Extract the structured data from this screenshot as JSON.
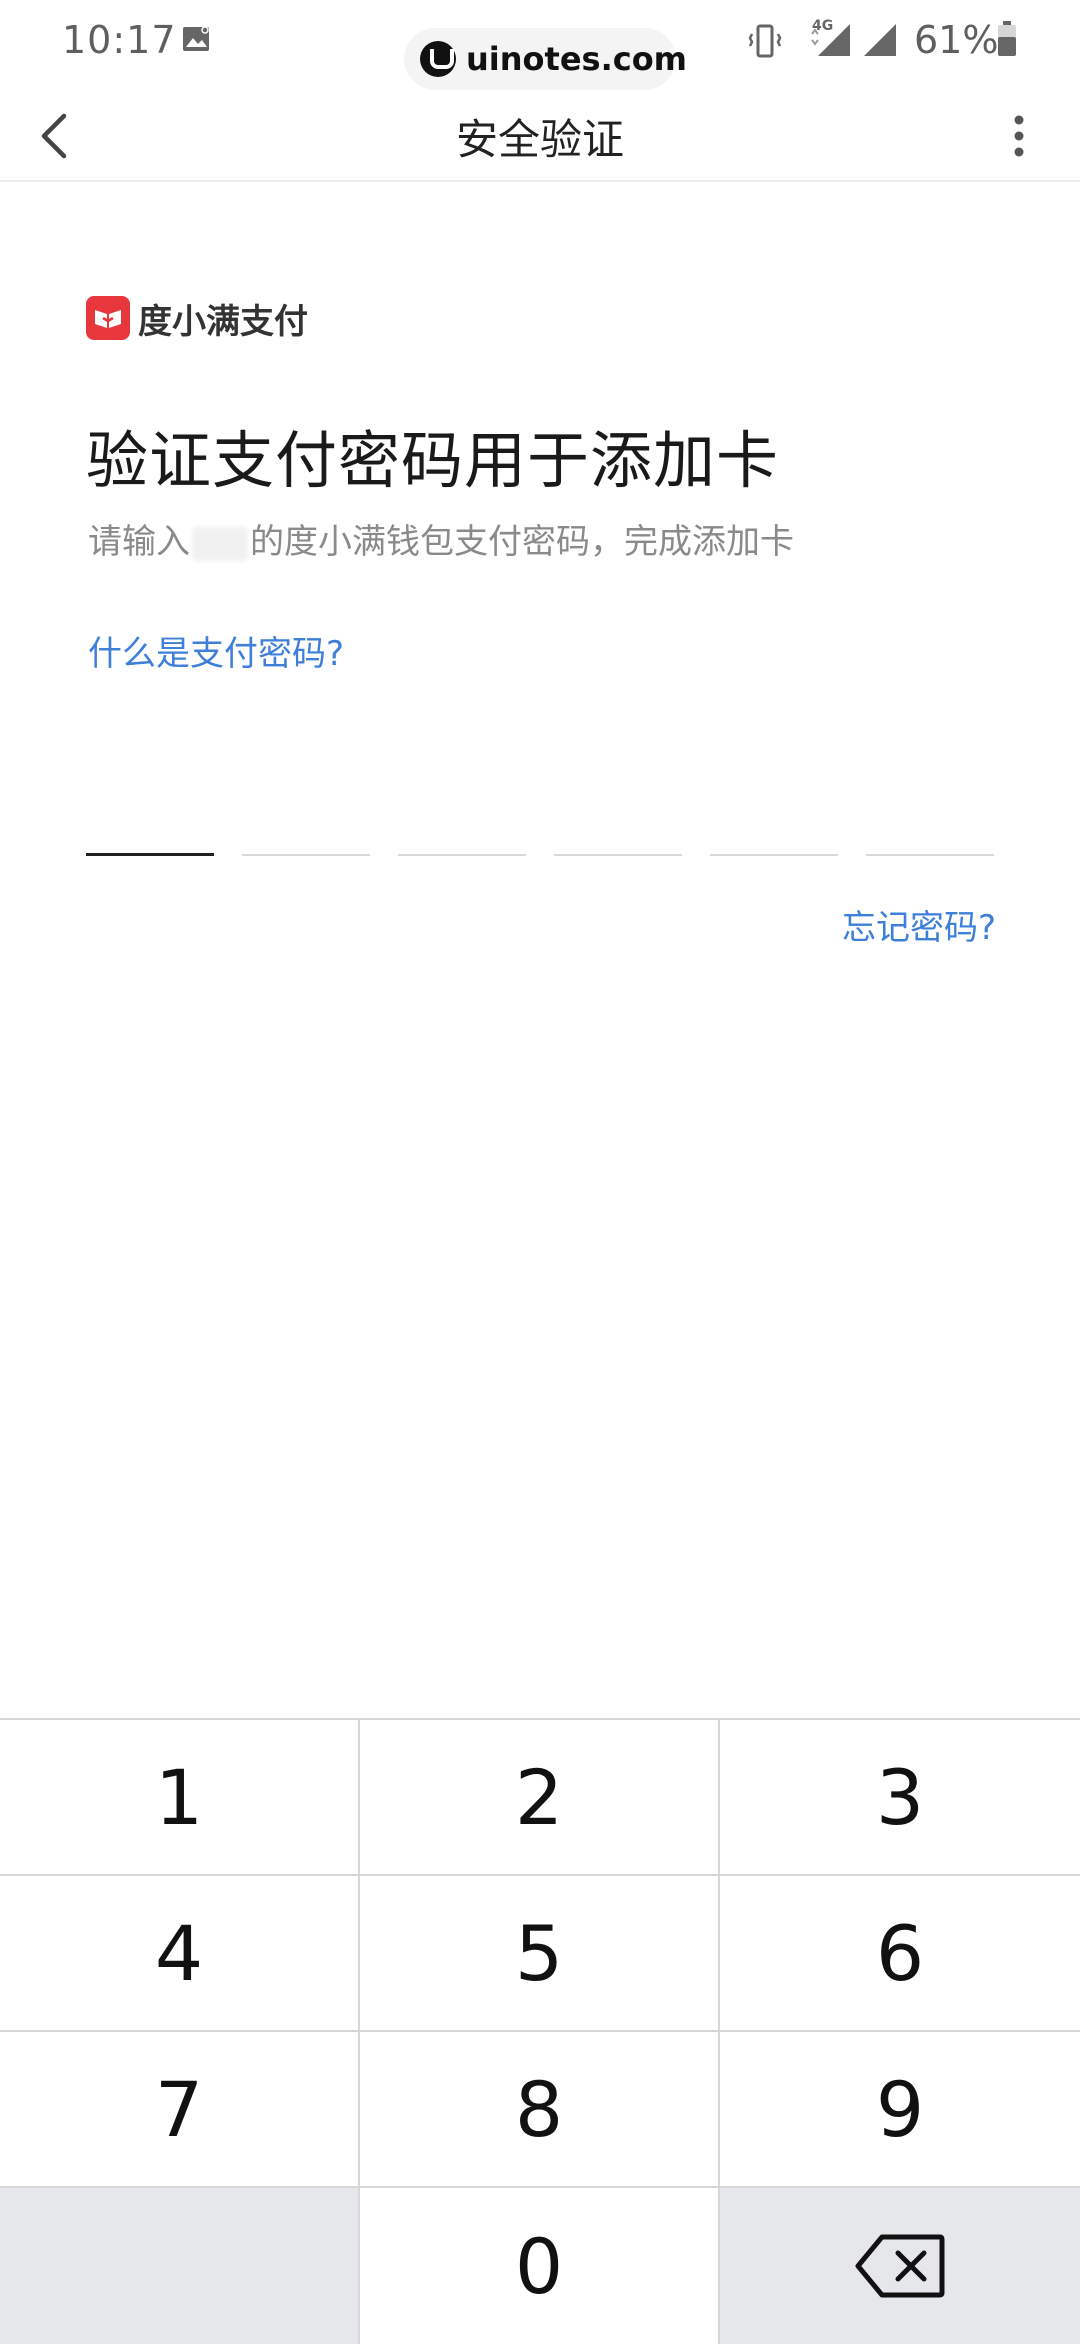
{
  "status_bar": {
    "time": "10:17",
    "domain": "uinotes.com",
    "network": "4G",
    "battery": "61%",
    "icons": [
      "image-icon",
      "vibrate-icon",
      "signal-icon",
      "signal-icon",
      "battery-icon"
    ]
  },
  "app_bar": {
    "title": "安全验证",
    "back_icon": "chevron-left-icon",
    "more_icon": "more-vertical-icon"
  },
  "brand": {
    "name": "度小满支付",
    "color": "#e8363d"
  },
  "main": {
    "heading": "验证支付密码用于添加卡",
    "subtitle_prefix": "请输入",
    "subtitle_suffix": "的度小满钱包支付密码，完成添加卡",
    "what_is_link": "什么是支付密码?",
    "pin_length": 6,
    "forgot_link": "忘记密码?",
    "link_color": "#3d7fd9"
  },
  "keypad": {
    "keys": [
      "1",
      "2",
      "3",
      "4",
      "5",
      "6",
      "7",
      "8",
      "9",
      "",
      "0",
      "backspace"
    ],
    "delete_icon": "backspace-icon"
  }
}
